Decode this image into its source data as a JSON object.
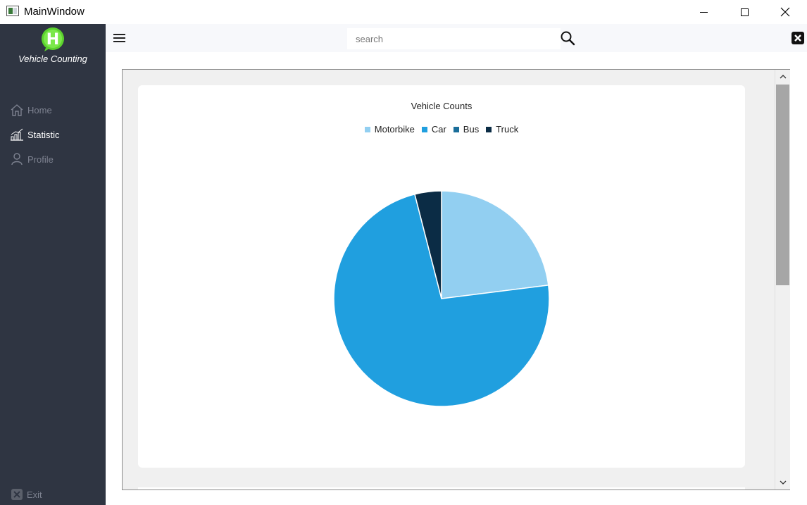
{
  "window": {
    "title": "MainWindow"
  },
  "sidebar": {
    "app_name": "Vehicle Counting",
    "logo_letter": "H",
    "items": [
      {
        "label": "Home",
        "icon": "home-icon",
        "active": false
      },
      {
        "label": "Statistic",
        "icon": "bar-chart-icon",
        "active": true
      },
      {
        "label": "Profile",
        "icon": "user-icon",
        "active": false
      }
    ],
    "exit_label": "Exit"
  },
  "topbar": {
    "search_placeholder": "search",
    "menu_icon": "hamburger-icon",
    "search_icon": "magnifier-icon",
    "close_icon": "close-box-icon"
  },
  "colors": {
    "sidebar_bg": "#2f3542",
    "accent_green": "#5cd22e"
  },
  "chart_data": {
    "type": "pie",
    "title": "Vehicle Counts",
    "legend_position": "top",
    "categories": [
      "Motorbike",
      "Car",
      "Bus",
      "Truck"
    ],
    "values": [
      23,
      73,
      0,
      4
    ],
    "colors": [
      "#92cff1",
      "#209fdf",
      "#1a6e9a",
      "#0b2c45"
    ]
  }
}
